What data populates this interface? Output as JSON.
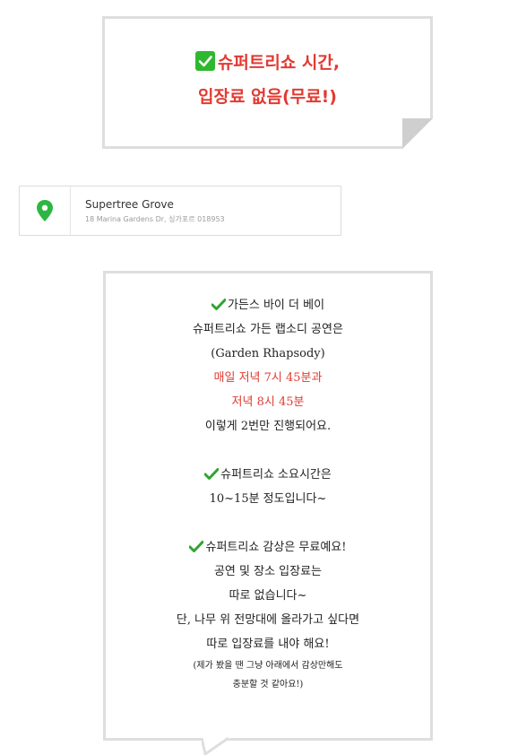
{
  "header_callout": {
    "line1": "슈퍼트리쇼 시간,",
    "line2": "입장료 없음(무료!)",
    "icon": "check-box-icon",
    "accent_color": "#e13a32"
  },
  "place_card": {
    "name": "Supertree Grove",
    "address": "18 Marina Gardens Dr, 싱가포르 018953",
    "icon": "map-pin-icon",
    "pin_color": "#2db742"
  },
  "info_box": {
    "section1": {
      "heading": "가든스 바이 더 베이",
      "line1": "슈퍼트리쇼 가든 랩소디 공연은",
      "line2": "(Garden Rhapsody)",
      "time1": "매일 저녁 7시 45분과",
      "time2": "저녁 8시 45분",
      "line3": "이렇게 2번만 진행되어요."
    },
    "section2": {
      "heading": "슈퍼트리쇼 소요시간은",
      "line1": "10~15분 정도입니다~"
    },
    "section3": {
      "heading": "슈퍼트리쇼 감상은 무료예요!",
      "line1": "공연 및 장소 입장료는",
      "line2": "따로 없습니다~",
      "line3": "단, 나무 위 전망대에 올라가고 싶다면",
      "line4": "따로 입장료를 내야 해요!",
      "note1": "(제가 봤을 땐 그냥 아래에서 감상만해도",
      "note2": "충분할 것 같아요!)"
    },
    "check_icon_color": "#2fa52f"
  }
}
